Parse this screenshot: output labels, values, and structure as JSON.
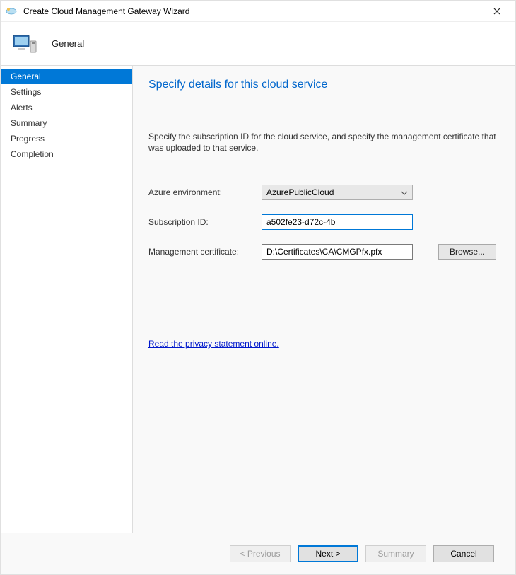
{
  "window": {
    "title": "Create Cloud Management Gateway Wizard"
  },
  "header": {
    "section_title": "General"
  },
  "sidebar": {
    "items": [
      {
        "label": "General",
        "selected": true
      },
      {
        "label": "Settings",
        "selected": false
      },
      {
        "label": "Alerts",
        "selected": false
      },
      {
        "label": "Summary",
        "selected": false
      },
      {
        "label": "Progress",
        "selected": false
      },
      {
        "label": "Completion",
        "selected": false
      }
    ]
  },
  "content": {
    "heading": "Specify details for this cloud service",
    "description": "Specify the subscription ID for the cloud service, and specify the management certificate that was uploaded to that service.",
    "fields": {
      "azure_env": {
        "label": "Azure environment:",
        "value": "AzurePublicCloud"
      },
      "subscription": {
        "label": "Subscription ID:",
        "value": "a502fe23-d72c-4b"
      },
      "certificate": {
        "label": "Management certificate:",
        "value": "D:\\Certificates\\CA\\CMGPfx.pfx",
        "browse_label": "Browse..."
      }
    },
    "privacy_link": "Read the privacy statement online."
  },
  "footer": {
    "previous": "< Previous",
    "next": "Next >",
    "summary": "Summary",
    "cancel": "Cancel"
  }
}
